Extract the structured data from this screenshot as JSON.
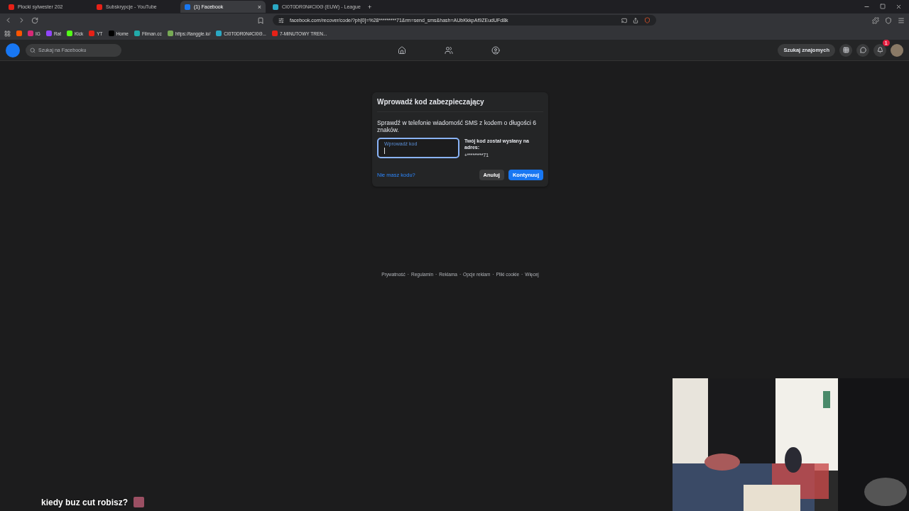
{
  "tabs": [
    {
      "title": "Płocki sylwester 202",
      "selected": false
    },
    {
      "title": "Subskrypcje - YouTube",
      "selected": false
    },
    {
      "title": "(1) Facebook",
      "selected": true,
      "close": "×"
    },
    {
      "title": "CI0T0DR0N#CI0Θ (EUW) - League",
      "selected": false
    }
  ],
  "new_tab": "+",
  "address": "facebook.com/recover/code/?ph[0]=%28*********71&rm=send_sms&hash=AUbKkkpAf9ZEudUFd8k",
  "bookmarks": [
    {
      "label": "IG"
    },
    {
      "label": "Rat"
    },
    {
      "label": "Kick"
    },
    {
      "label": "YT"
    },
    {
      "label": "Home"
    },
    {
      "label": "Filman.cc"
    },
    {
      "label": "https://tanggle.io/"
    },
    {
      "label": "CI0T0DR0N#CI0Θ..."
    },
    {
      "label": "7-MINUTOWY TREN..."
    }
  ],
  "facebook": {
    "search_placeholder": "Szukaj na Facebooku",
    "find_friends": "Szukaj znajomych",
    "notification_count": "1"
  },
  "dialog": {
    "title": "Wprowadź kod zabezpieczający",
    "message": "Sprawdź w telefonie wiadomość SMS z kodem o długości 6 znaków.",
    "code_label": "Wprowadź kod",
    "sent_to_label": "Twój kod został wysłany na adres:",
    "phone": "+*********71",
    "no_code_link": "Nie masz kodu?",
    "cancel": "Anuluj",
    "continue": "Kontynuuj"
  },
  "footer_links": [
    "Prywatność",
    "Regulamin",
    "Reklama",
    "Opcje reklam",
    "Pliki cookie",
    "Więcej"
  ],
  "separator": "·",
  "chat_message": "kiedy buz cut robisz?"
}
